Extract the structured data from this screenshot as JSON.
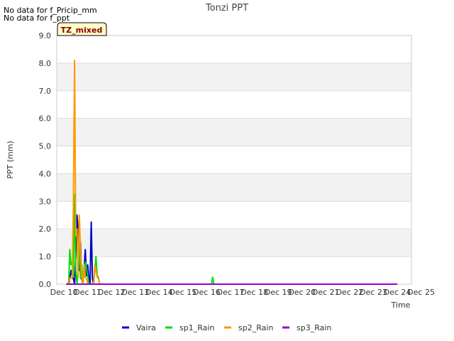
{
  "notes": [
    "No data for f_Pricip_mm",
    "No data for f_ppt"
  ],
  "badge": "TZ_mixed",
  "colors": {
    "band": "#f2f2f2",
    "grid": "#dcdcdc",
    "badge_bg": "#ffffcc",
    "badge_text": "#8b0000"
  },
  "chart_data": {
    "type": "line",
    "title": "Tonzi PPT",
    "xlabel": "Time",
    "ylabel": "PPT (mm)",
    "xlim": [
      "Dec 10",
      "Dec 25"
    ],
    "ylim": [
      0,
      9
    ],
    "grid": true,
    "legend_position": "bottom",
    "x_ticks": [
      "Dec 10",
      "Dec 11",
      "Dec 12",
      "Dec 13",
      "Dec 14",
      "Dec 15",
      "Dec 16",
      "Dec 17",
      "Dec 18",
      "Dec 19",
      "Dec 20",
      "Dec 21",
      "Dec 22",
      "Dec 23",
      "Dec 24",
      "Dec 25"
    ],
    "y_ticks": [
      "0.0",
      "1.0",
      "2.0",
      "3.0",
      "4.0",
      "5.0",
      "6.0",
      "7.0",
      "8.0",
      "9.0"
    ],
    "series": [
      {
        "name": "Vaira",
        "color": "#0000cc",
        "x": [
          10.2,
          10.25,
          10.3,
          10.35,
          10.4,
          10.45,
          10.5,
          10.55,
          10.6,
          10.65,
          10.7,
          10.75,
          10.8,
          10.85,
          10.9,
          10.95,
          11.0,
          11.05,
          11.1,
          11.15,
          11.2,
          11.25,
          11.3,
          11.35,
          11.4,
          11.45,
          11.5
        ],
        "y": [
          0,
          0.2,
          0.5,
          0.3,
          0.2,
          0,
          1.0,
          2.5,
          2.0,
          0.5,
          1.5,
          0.2,
          0,
          0.5,
          1.25,
          0.3,
          0.7,
          0.2,
          0,
          2.25,
          0.2,
          0,
          0,
          0,
          0,
          0,
          0
        ]
      },
      {
        "name": "sp1_Rain",
        "color": "#00dd00",
        "x": [
          10.2,
          10.25,
          10.3,
          10.35,
          10.4,
          10.45,
          10.5,
          10.55,
          10.6,
          10.65,
          10.7,
          10.75,
          10.8,
          10.85,
          10.9,
          10.95,
          11.0,
          11.05,
          11.1,
          11.15,
          11.2,
          11.25,
          11.3,
          11.35,
          11.4,
          11.45,
          11.5,
          11.55,
          16.2,
          16.25,
          16.3
        ],
        "y": [
          0,
          1.25,
          0.7,
          0.8,
          0.3,
          3.25,
          0.5,
          0,
          0.5,
          1.5,
          0.2,
          0.7,
          0,
          0.5,
          0.8,
          0.6,
          0.3,
          0,
          0,
          0,
          0,
          0,
          0.5,
          1.0,
          0.3,
          0.25,
          0,
          0,
          0,
          0.25,
          0
        ]
      },
      {
        "name": "sp2_Rain",
        "color": "#ff9900",
        "x": [
          10.15,
          10.25,
          10.3,
          10.35,
          10.4,
          10.45,
          10.5,
          10.55,
          10.6,
          10.65,
          10.7,
          10.75,
          10.8,
          10.85,
          10.9,
          10.95,
          11.0,
          11.05,
          11.1,
          11.15,
          11.2,
          11.25,
          11.3,
          11.35,
          11.4,
          11.45,
          11.5,
          11.55
        ],
        "y": [
          0,
          0.2,
          0.25,
          0.2,
          2.75,
          8.1,
          1.75,
          2.0,
          0.25,
          2.5,
          1.25,
          0.3,
          0,
          0.7,
          0.25,
          0.2,
          0,
          0,
          0,
          0,
          0,
          0,
          0.7,
          0.5,
          0.25,
          0.2,
          0,
          0
        ]
      },
      {
        "name": "sp3_Rain",
        "color": "#9900cc",
        "x": [
          10.1,
          24.0
        ],
        "y": [
          0,
          0
        ]
      }
    ]
  }
}
